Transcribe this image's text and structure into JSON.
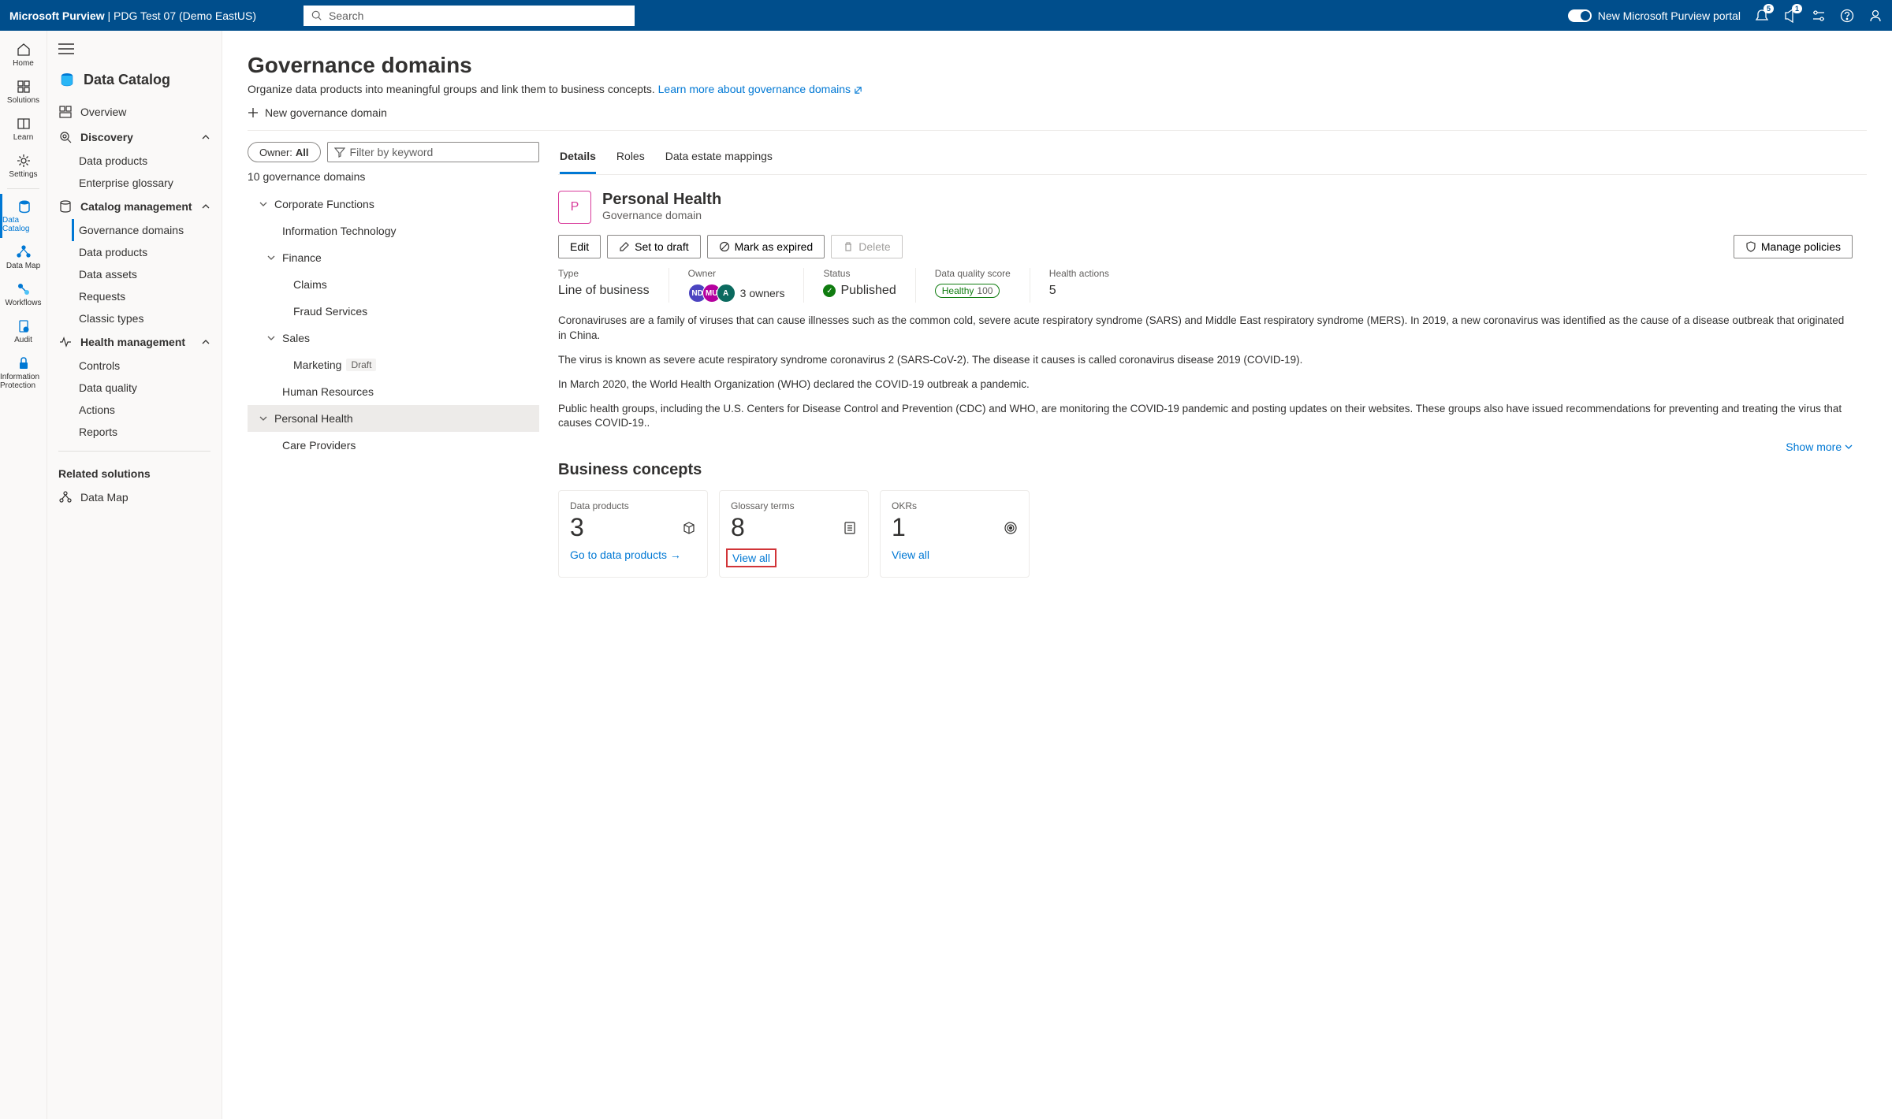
{
  "header": {
    "brand": "Microsoft Purview",
    "account": "PDG Test 07 (Demo EastUS)",
    "search_placeholder": "Search",
    "toggle_label": "New Microsoft Purview portal",
    "notif_badge": "5",
    "whatsnew_badge": "1"
  },
  "rail": {
    "home": "Home",
    "solutions": "Solutions",
    "learn": "Learn",
    "settings": "Settings",
    "data_catalog": "Data Catalog",
    "data_map": "Data Map",
    "workflows": "Workflows",
    "audit": "Audit",
    "info_protection": "Information Protection"
  },
  "sidenav": {
    "title": "Data Catalog",
    "overview": "Overview",
    "discovery": "Discovery",
    "data_products": "Data products",
    "enterprise_glossary": "Enterprise glossary",
    "catalog_management": "Catalog management",
    "governance_domains": "Governance domains",
    "data_products2": "Data products",
    "data_assets": "Data assets",
    "requests": "Requests",
    "classic_types": "Classic types",
    "health_management": "Health management",
    "controls": "Controls",
    "data_quality": "Data quality",
    "actions": "Actions",
    "reports": "Reports",
    "related_solutions": "Related solutions",
    "data_map": "Data Map"
  },
  "page": {
    "title": "Governance domains",
    "desc": "Organize data products into meaningful groups and link them to business concepts.",
    "learn_more": "Learn more about governance domains",
    "new_domain": "New governance domain"
  },
  "filter": {
    "owner_label": "Owner:",
    "owner_value": "All",
    "filter_placeholder": "Filter by keyword",
    "count": "10 governance domains"
  },
  "tree": {
    "corporate": "Corporate Functions",
    "it": "Information Technology",
    "finance": "Finance",
    "claims": "Claims",
    "fraud": "Fraud Services",
    "sales": "Sales",
    "marketing": "Marketing",
    "draft": "Draft",
    "hr": "Human Resources",
    "personal_health": "Personal Health",
    "care_providers": "Care Providers"
  },
  "tabs": {
    "details": "Details",
    "roles": "Roles",
    "data_estate": "Data estate mappings"
  },
  "detail": {
    "avatar": "P",
    "title": "Personal Health",
    "subtitle": "Governance domain",
    "edit": "Edit",
    "set_draft": "Set to draft",
    "mark_expired": "Mark as expired",
    "delete": "Delete",
    "manage_policies": "Manage policies"
  },
  "meta": {
    "type_label": "Type",
    "type_value": "Line of business",
    "owner_label": "Owner",
    "owner_count": "3 owners",
    "owner1": "ND",
    "owner2": "MU",
    "owner3": "A",
    "status_label": "Status",
    "status_value": "Published",
    "dq_label": "Data quality score",
    "dq_value": "Healthy",
    "dq_num": "100",
    "ha_label": "Health actions",
    "ha_value": "5"
  },
  "desc": {
    "p1": "Coronaviruses are a family of viruses that can cause illnesses such as the common cold, severe acute respiratory syndrome (SARS) and Middle East respiratory syndrome (MERS). In 2019, a new coronavirus was identified as the cause of a disease outbreak that originated in China.",
    "p2": "The virus is known as severe acute respiratory syndrome coronavirus 2 (SARS-CoV-2). The disease it causes is called coronavirus disease 2019 (COVID-19).",
    "p3": "In March 2020, the World Health Organization (WHO) declared the COVID-19 outbreak a pandemic.",
    "p4": "Public health groups, including the U.S. Centers for Disease Control and Prevention (CDC) and WHO, are monitoring the COVID-19 pandemic and posting updates on their websites. These groups also have issued recommendations for preventing and treating the virus that causes COVID-19..",
    "show_more": "Show more"
  },
  "concepts": {
    "heading": "Business concepts",
    "dp_label": "Data products",
    "dp_num": "3",
    "dp_link": "Go to data products",
    "gt_label": "Glossary terms",
    "gt_num": "8",
    "gt_link": "View all",
    "okr_label": "OKRs",
    "okr_num": "1",
    "okr_link": "View all"
  }
}
